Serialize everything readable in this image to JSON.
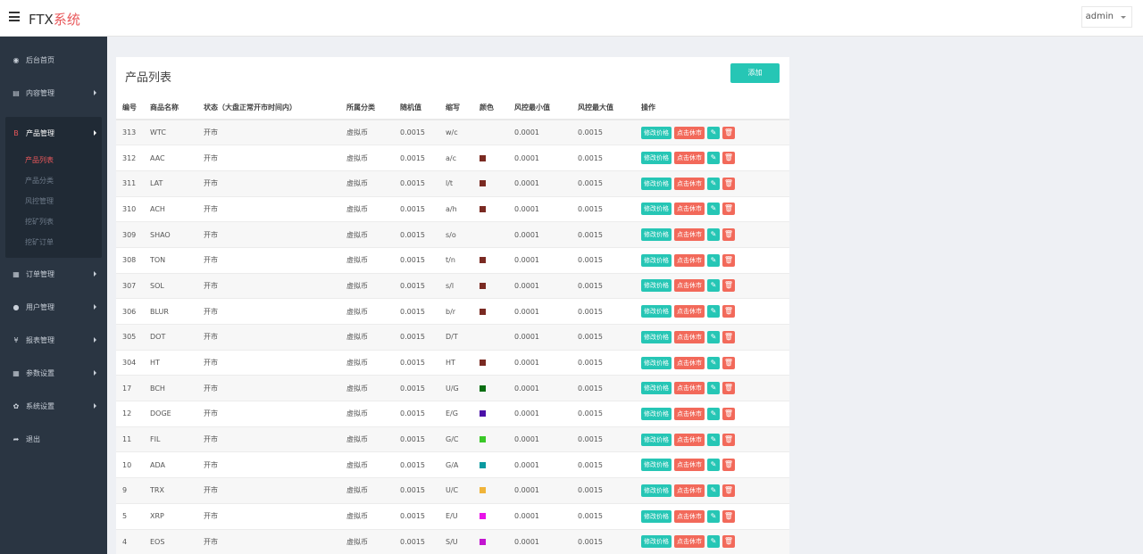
{
  "header": {
    "brand_main": "FTX",
    "brand_accent": "系统",
    "user": "admin"
  },
  "sidebar": {
    "items": [
      {
        "label": "后台首页",
        "icon": "dashboard-icon",
        "glyph": "◉"
      },
      {
        "label": "内容管理",
        "icon": "content-icon",
        "glyph": "▤"
      },
      {
        "label": "产品管理",
        "icon": "bitcoin-icon",
        "glyph": "B"
      },
      {
        "label": "订单管理",
        "icon": "order-icon",
        "glyph": "▦"
      },
      {
        "label": "用户管理",
        "icon": "user-icon",
        "glyph": "●"
      },
      {
        "label": "报表管理",
        "icon": "yen-icon",
        "glyph": "¥"
      },
      {
        "label": "参数设置",
        "icon": "settings-icon",
        "glyph": "▦"
      },
      {
        "label": "系统设置",
        "icon": "cogs-icon",
        "glyph": "✿"
      },
      {
        "label": "退出",
        "icon": "logout-icon",
        "glyph": "➦"
      }
    ],
    "product_sub": [
      "产品列表",
      "产品分类",
      "风控管理",
      "挖矿列表",
      "挖矿订单"
    ]
  },
  "panel": {
    "title": "产品列表",
    "add_label": "添加"
  },
  "table": {
    "headers": [
      "编号",
      "商品名称",
      "状态（大盘正常开市时间内）",
      "所属分类",
      "随机值",
      "缩写",
      "颜色",
      "风控最小值",
      "风控最大值",
      "操作"
    ],
    "action_edit_price": "修改价格",
    "action_close": "点击休市",
    "action_edit_glyph": "✎",
    "action_delete_glyph": "🗑",
    "rows": [
      {
        "id": "313",
        "name": "WTC",
        "status": "开市",
        "category": "虚拟币",
        "random": "0.0015",
        "abbr": "w/c",
        "color": "",
        "min": "0.0001",
        "max": "0.0015"
      },
      {
        "id": "312",
        "name": "AAC",
        "status": "开市",
        "category": "虚拟币",
        "random": "0.0015",
        "abbr": "a/c",
        "color": "#7a2a22",
        "min": "0.0001",
        "max": "0.0015"
      },
      {
        "id": "311",
        "name": "LAT",
        "status": "开市",
        "category": "虚拟币",
        "random": "0.0015",
        "abbr": "l/t",
        "color": "#7a2a22",
        "min": "0.0001",
        "max": "0.0015"
      },
      {
        "id": "310",
        "name": "ACH",
        "status": "开市",
        "category": "虚拟币",
        "random": "0.0015",
        "abbr": "a/h",
        "color": "#7a2a22",
        "min": "0.0001",
        "max": "0.0015"
      },
      {
        "id": "309",
        "name": "SHAO",
        "status": "开市",
        "category": "虚拟币",
        "random": "0.0015",
        "abbr": "s/o",
        "color": "",
        "min": "0.0001",
        "max": "0.0015"
      },
      {
        "id": "308",
        "name": "TON",
        "status": "开市",
        "category": "虚拟币",
        "random": "0.0015",
        "abbr": "t/n",
        "color": "#7a2a22",
        "min": "0.0001",
        "max": "0.0015"
      },
      {
        "id": "307",
        "name": "SOL",
        "status": "开市",
        "category": "虚拟币",
        "random": "0.0015",
        "abbr": "s/l",
        "color": "#7a2a22",
        "min": "0.0001",
        "max": "0.0015"
      },
      {
        "id": "306",
        "name": "BLUR",
        "status": "开市",
        "category": "虚拟币",
        "random": "0.0015",
        "abbr": "b/r",
        "color": "#7a2a22",
        "min": "0.0001",
        "max": "0.0015"
      },
      {
        "id": "305",
        "name": "DOT",
        "status": "开市",
        "category": "虚拟币",
        "random": "0.0015",
        "abbr": "D/T",
        "color": "",
        "min": "0.0001",
        "max": "0.0015"
      },
      {
        "id": "304",
        "name": "HT",
        "status": "开市",
        "category": "虚拟币",
        "random": "0.0015",
        "abbr": "HT",
        "color": "#7a2a22",
        "min": "0.0001",
        "max": "0.0015"
      },
      {
        "id": "17",
        "name": "BCH",
        "status": "开市",
        "category": "虚拟币",
        "random": "0.0015",
        "abbr": "U/G",
        "color": "#0a6e12",
        "min": "0.0001",
        "max": "0.0015"
      },
      {
        "id": "12",
        "name": "DOGE",
        "status": "开市",
        "category": "虚拟币",
        "random": "0.0015",
        "abbr": "E/G",
        "color": "#4b11a8",
        "min": "0.0001",
        "max": "0.0015"
      },
      {
        "id": "11",
        "name": "FIL",
        "status": "开市",
        "category": "虚拟币",
        "random": "0.0015",
        "abbr": "G/C",
        "color": "#3ac828",
        "min": "0.0001",
        "max": "0.0015"
      },
      {
        "id": "10",
        "name": "ADA",
        "status": "开市",
        "category": "虚拟币",
        "random": "0.0015",
        "abbr": "G/A",
        "color": "#0a9aa0",
        "min": "0.0001",
        "max": "0.0015"
      },
      {
        "id": "9",
        "name": "TRX",
        "status": "开市",
        "category": "虚拟币",
        "random": "0.0015",
        "abbr": "U/C",
        "color": "#f0b43a",
        "min": "0.0001",
        "max": "0.0015"
      },
      {
        "id": "5",
        "name": "XRP",
        "status": "开市",
        "category": "虚拟币",
        "random": "0.0015",
        "abbr": "E/U",
        "color": "#e812e8",
        "min": "0.0001",
        "max": "0.0015"
      },
      {
        "id": "4",
        "name": "EOS",
        "status": "开市",
        "category": "虚拟币",
        "random": "0.0015",
        "abbr": "S/U",
        "color": "#c214d0",
        "min": "0.0001",
        "max": "0.0015"
      }
    ]
  }
}
